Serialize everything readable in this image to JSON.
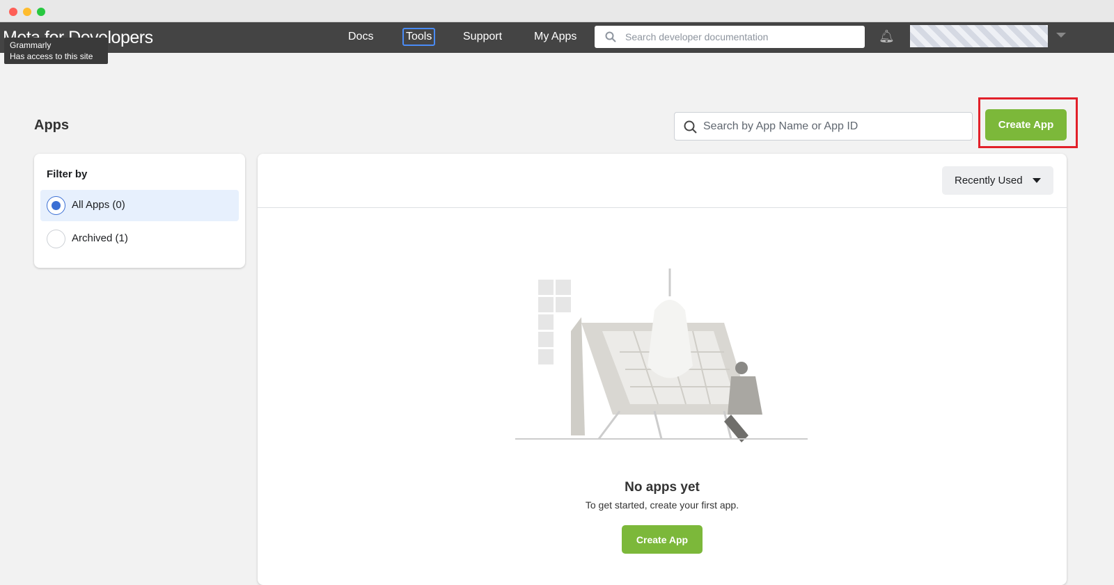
{
  "window": {
    "controls": [
      "close",
      "minimize",
      "maximize"
    ]
  },
  "nav": {
    "logo": "Meta for Developers",
    "links": [
      "Docs",
      "Tools",
      "Support",
      "My Apps"
    ],
    "search_placeholder": "Search developer documentation"
  },
  "tooltip": {
    "title": "Grammarly",
    "text": "Has access to this site"
  },
  "page": {
    "title": "Apps",
    "search_placeholder": "Search by App Name or App ID",
    "create_label": "Create App"
  },
  "filter": {
    "heading": "Filter by",
    "items": [
      {
        "label": "All Apps (0)",
        "selected": true
      },
      {
        "label": "Archived (1)",
        "selected": false
      }
    ]
  },
  "list": {
    "sort_label": "Recently Used",
    "empty_title": "No apps yet",
    "empty_text": "To get started, create your first app.",
    "create_label": "Create App"
  },
  "colors": {
    "accent_green": "#7cb83a",
    "highlight_red": "#e2202a",
    "selected_blue": "#3b6fd4"
  }
}
